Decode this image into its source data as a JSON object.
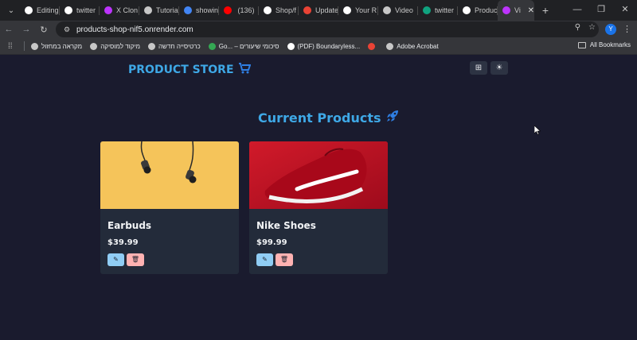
{
  "browser": {
    "tabs": [
      {
        "label": "Editing",
        "icon": "github-icon",
        "color": "#ffffff"
      },
      {
        "label": "twitter",
        "icon": "render-icon",
        "color": "#ffffff"
      },
      {
        "label": "X Clon",
        "icon": "vite-icon",
        "color": "#bd34fe"
      },
      {
        "label": "Tutoria",
        "icon": "globe-icon",
        "color": "#c7c7c7"
      },
      {
        "label": "showin",
        "icon": "google-icon",
        "color": "#4285f4"
      },
      {
        "label": "‏(136) ‏",
        "icon": "youtube-icon",
        "color": "#ff0000"
      },
      {
        "label": "Shop/f",
        "icon": "github-icon",
        "color": "#ffffff"
      },
      {
        "label": "Update",
        "icon": "gmail-icon",
        "color": "#ea4335"
      },
      {
        "label": "Your R",
        "icon": "github-icon",
        "color": "#ffffff"
      },
      {
        "label": "Video",
        "icon": "video-icon",
        "color": "#c7c7c7"
      },
      {
        "label": "twitter",
        "icon": "chatgpt-icon",
        "color": "#10a37f"
      },
      {
        "label": "Produc",
        "icon": "render-icon",
        "color": "#ffffff"
      },
      {
        "label": "Vi",
        "icon": "vite-icon",
        "color": "#bd34fe"
      }
    ],
    "url": "products-shop-nif5.onrender.com",
    "profile_initial": "Y",
    "bookmarks": [
      {
        "label": "מקראה במחזול",
        "color": "#c7c7c7"
      },
      {
        "label": "מיקוד למוסיקה",
        "color": "#c7c7c7"
      },
      {
        "label": "כרטיסייה חדשה",
        "color": "#c7c7c7"
      },
      {
        "label": "Go... – סיכומי שיעורים",
        "color": "#34a853"
      },
      {
        "label": "(PDF) Boundaryless...",
        "color": "#ffffff"
      },
      {
        "label": "",
        "color": "#ea4335"
      },
      {
        "label": "Adobe Acrobat",
        "color": "#c7c7c7"
      }
    ],
    "all_bookmarks": "All Bookmarks"
  },
  "page": {
    "brand": "PRODUCT STORE",
    "section_title": "Current Products",
    "products": [
      {
        "name": "Earbuds",
        "price": "$39.99",
        "image_bg": "#f5c45a"
      },
      {
        "name": "Nike Shoes",
        "price": "$99.99",
        "image_bg": "#c8102e"
      }
    ]
  }
}
